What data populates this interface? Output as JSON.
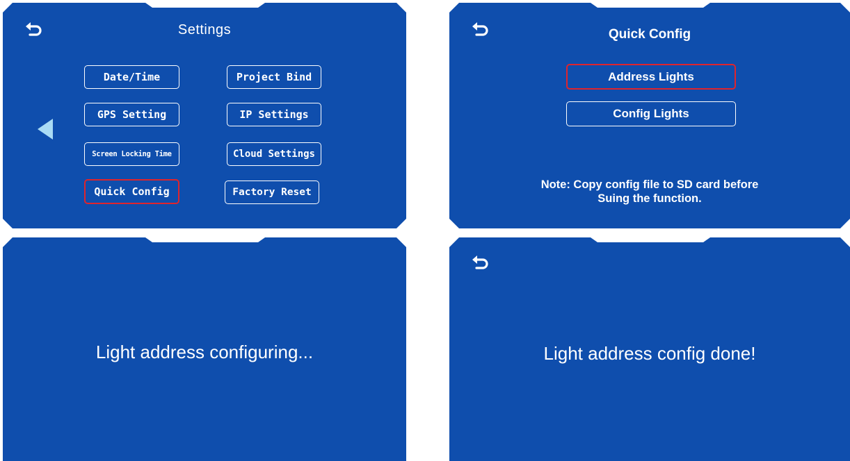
{
  "screens": {
    "settings": {
      "title": "Settings",
      "left_column": [
        "Date/Time",
        "GPS Setting",
        "Screen Locking Time",
        "Quick Config"
      ],
      "right_column": [
        "Project Bind",
        "IP Settings",
        "Cloud Settings",
        "Factory Reset"
      ],
      "selected": "Quick Config"
    },
    "quick_config": {
      "title": "Quick Config",
      "address_lights_label": "Address Lights",
      "config_lights_label": "Config Lights",
      "note_line1": "Note: Copy config file to SD card before",
      "note_line2": "Suing the function."
    },
    "configuring": {
      "message": "Light address configuring..."
    },
    "done": {
      "message": "Light address config done!"
    }
  },
  "colors": {
    "panel": "#0f4ead",
    "panel_dark": "#0b3f94",
    "text": "#ffffff",
    "selected_border": "#e0242c",
    "page_arrow": "#a9dbf5"
  },
  "icons": {
    "back": "back-arrow-icon",
    "page_prev": "triangle-left-icon"
  }
}
